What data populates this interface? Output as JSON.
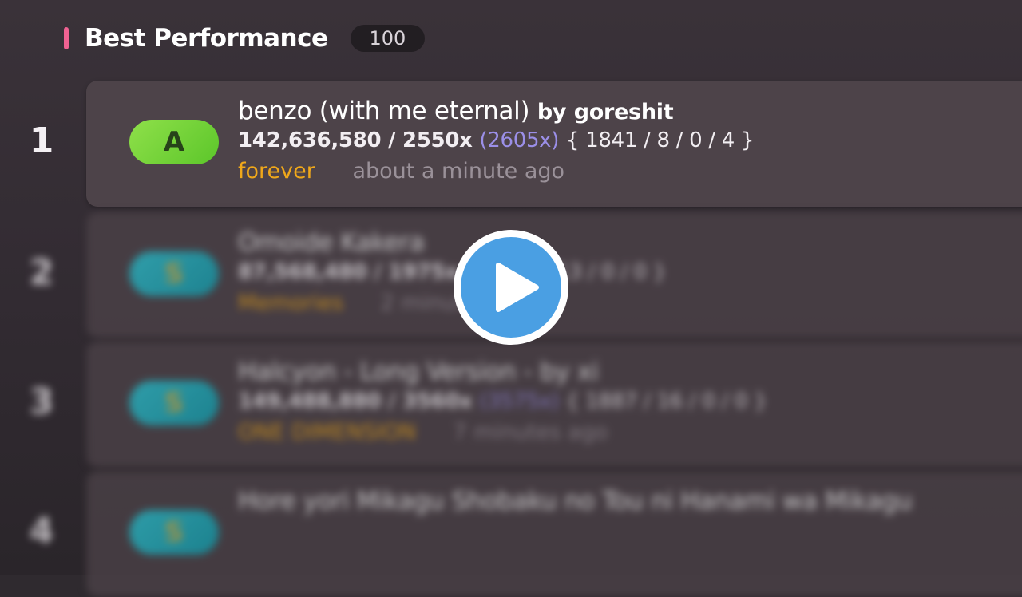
{
  "header": {
    "title": "Best Performance",
    "count": "100"
  },
  "scores": [
    {
      "rank": "1",
      "grade": "A",
      "grade_class": "a",
      "title": "benzo (with me eternal)",
      "artist_prefix": "by",
      "artist": "goreshit",
      "score": "142,636,580 / 2550x",
      "max_combo": "(2605x)",
      "judgements": "{ 1841 / 8 / 0 / 4 }",
      "mod": "forever",
      "time": "about a minute ago"
    },
    {
      "rank": "2",
      "grade": "S",
      "grade_class": "s",
      "title": "Omoide Kakera",
      "artist_prefix": "",
      "artist": "",
      "score": "87,568,480 / 1975x",
      "max_combo": "",
      "judgements": "{ 1418 / 13 / 0 / 0 }",
      "mod": "Memories",
      "time": "2 minutes ago"
    },
    {
      "rank": "3",
      "grade": "S",
      "grade_class": "s",
      "title": "Halcyon - Long Version - by xi",
      "artist_prefix": "",
      "artist": "",
      "score": "149,488,880 / 3560x",
      "max_combo": "(3575x)",
      "judgements": "{ 1887 / 16 / 0 / 0 }",
      "mod": "ONE DIMENSION",
      "time": "7 minutes ago"
    },
    {
      "rank": "4",
      "grade": "S",
      "grade_class": "s",
      "title": "Hore yori Mikagu Shobaku no Tou ni Hanami wa Mikagu",
      "artist_prefix": "",
      "artist": "",
      "score": "",
      "max_combo": "",
      "judgements": "",
      "mod": "",
      "time": ""
    }
  ],
  "overlay": {
    "icon": "play-icon"
  },
  "colors": {
    "accent_pink": "#f06292",
    "mod_gold": "#f0a81a",
    "combo_purple": "#9b8fe8",
    "play_blue": "#4a9fe3"
  }
}
